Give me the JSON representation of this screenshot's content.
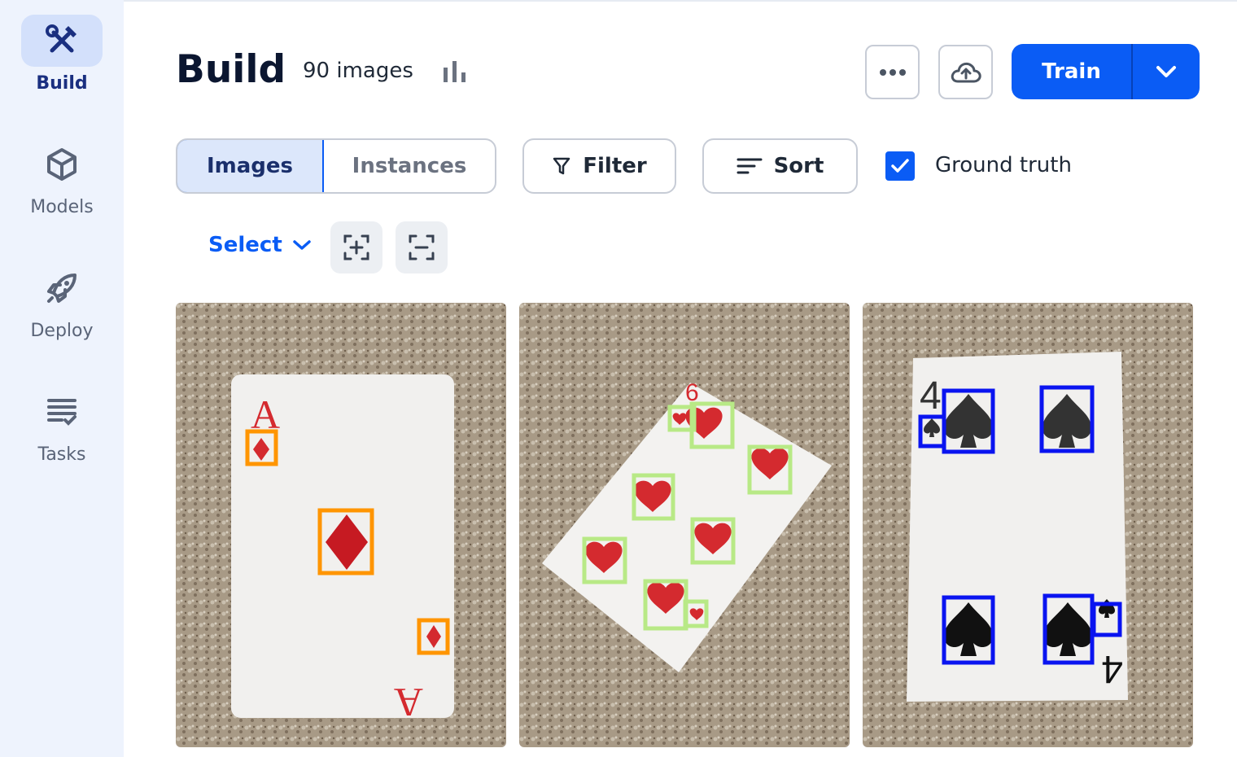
{
  "sidebar": {
    "items": [
      {
        "label": "Build",
        "icon": "tools-icon",
        "active": true
      },
      {
        "label": "Models",
        "icon": "cube-icon",
        "active": false
      },
      {
        "label": "Deploy",
        "icon": "rocket-icon",
        "active": false
      },
      {
        "label": "Tasks",
        "icon": "checklist-icon",
        "active": false
      }
    ]
  },
  "header": {
    "title": "Build",
    "image_count": "90 images",
    "train_label": "Train"
  },
  "toolbar": {
    "tabs": [
      {
        "label": "Images",
        "active": true
      },
      {
        "label": "Instances",
        "active": false
      }
    ],
    "filter_label": "Filter",
    "sort_label": "Sort",
    "ground_truth_label": "Ground truth",
    "ground_truth_checked": true,
    "select_label": "Select"
  },
  "gallery": {
    "images": [
      {
        "card": "Ace of Diamonds",
        "box_color": "#ff9500"
      },
      {
        "card": "Six of Hearts",
        "box_color": "#b8e986"
      },
      {
        "card": "Four of Spades",
        "box_color": "#0a14f0"
      }
    ]
  },
  "colors": {
    "accent": "#0a5cf5",
    "sidebar_bg": "#eef3fd",
    "nav_active": "#1a2f80"
  }
}
